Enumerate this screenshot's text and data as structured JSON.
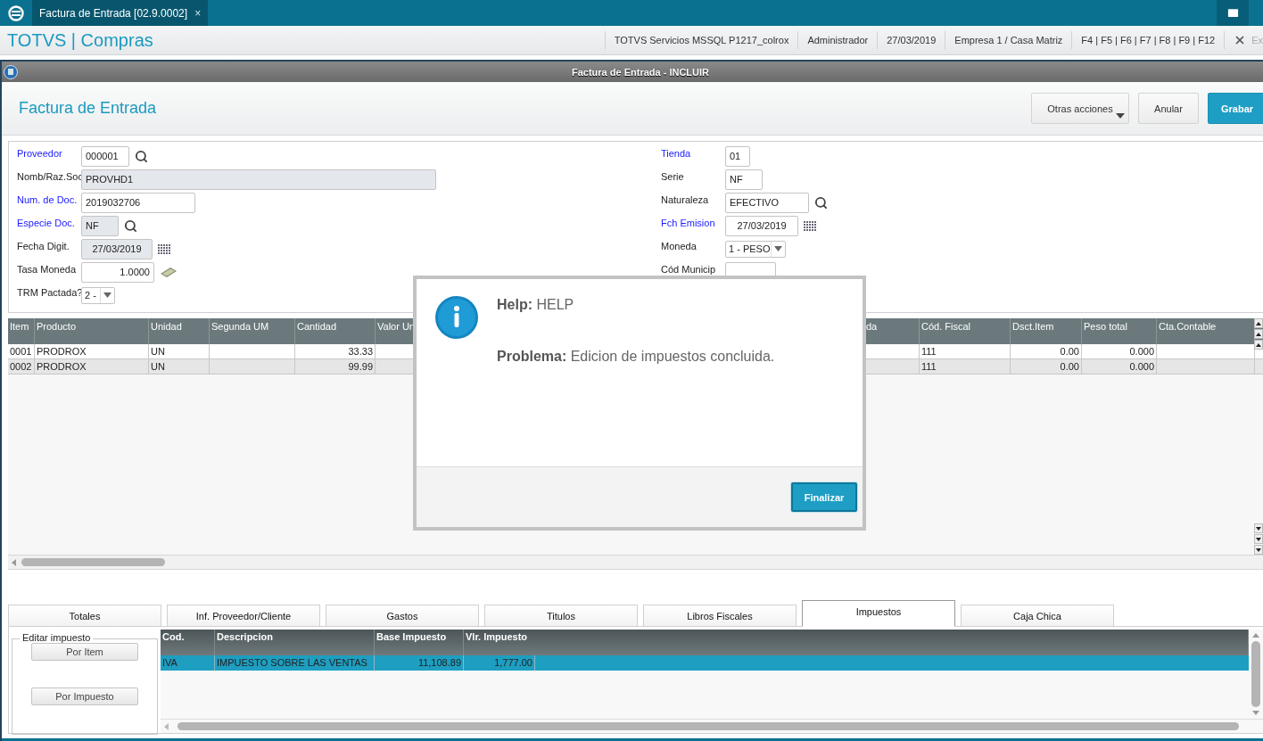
{
  "top_bar": {
    "tab": {
      "title": "Factura de Entrada [02.9.0002]",
      "close": "×"
    }
  },
  "app_bar": {
    "title": "TOTVS | Compras",
    "info": [
      "TOTVS Servicios MSSQL P1217_colrox",
      "Administrador",
      "27/03/2019",
      "Empresa 1 / Casa Matriz",
      "F4 | F5 | F6 | F7 | F8 | F9 | F12"
    ],
    "exit": "Ex"
  },
  "window": {
    "title": "Factura de Entrada - INCLUIR"
  },
  "page": {
    "title": "Factura de Entrada",
    "buttons": [
      {
        "label": "Otras acciones",
        "kind": "menu"
      },
      {
        "label": "Anular",
        "kind": "plain"
      },
      {
        "label": "Grabar",
        "kind": "primary"
      }
    ]
  },
  "form": {
    "left": [
      {
        "label": "Proveedor",
        "required": true,
        "value": "000001",
        "kind": "text",
        "action": {
          "kind": "search"
        }
      },
      {
        "label": "Nomb/Raz.Soc",
        "required": false,
        "value": "PROVHD1",
        "kind": "readonly"
      },
      {
        "label": "Num. de Doc.",
        "required": true,
        "value": "2019032706",
        "kind": "text"
      },
      {
        "label": "Especie Doc.",
        "required": true,
        "value": "NF",
        "kind": "readonly",
        "action": {
          "kind": "search"
        }
      },
      {
        "label": "Fecha Digit.",
        "required": false,
        "value": "27/03/2019",
        "kind": "readonly-date",
        "action": {
          "kind": "calendar"
        }
      },
      {
        "label": "Tasa Moneda",
        "required": false,
        "value": "1.0000",
        "kind": "number",
        "action": {
          "kind": "money"
        }
      },
      {
        "label": "TRM Pactada?",
        "required": false,
        "value": "2 -",
        "kind": "select"
      }
    ],
    "right": [
      {
        "label": "Tienda",
        "required": true,
        "value": "01",
        "kind": "text"
      },
      {
        "label": "Serie",
        "required": false,
        "value": "NF",
        "kind": "text"
      },
      {
        "label": "Naturaleza",
        "required": false,
        "value": "EFECTIVO",
        "kind": "text",
        "action": {
          "kind": "search"
        }
      },
      {
        "label": "Fch Emision",
        "required": true,
        "value": "27/03/2019",
        "kind": "date",
        "action": {
          "kind": "calendar"
        }
      },
      {
        "label": "Moneda",
        "required": false,
        "value": "1 - PESO",
        "kind": "select"
      },
      {
        "label": "Cód Municip",
        "required": false,
        "kind": "text"
      }
    ]
  },
  "items": {
    "columns": [
      "Item",
      "Producto",
      "Unidad",
      "Segunda UM",
      "Cantidad",
      "Valor Un",
      "da",
      "Cód. Fiscal",
      "Dsct.Item",
      "Peso total",
      "Cta.Contable"
    ],
    "rows": [
      {
        "item": "0001",
        "producto": "PRODROX",
        "unidad": "UN",
        "cantidad": "33.33",
        "cod_fiscal": "111",
        "dsct_item": "0.00",
        "peso_total": "0.000"
      },
      {
        "item": "0002",
        "producto": "PRODROX",
        "unidad": "UN",
        "cantidad": "99.99",
        "cod_fiscal": "111",
        "dsct_item": "0.00",
        "peso_total": "0.000"
      }
    ]
  },
  "tabs": [
    {
      "label": "Totales",
      "selected": false
    },
    {
      "label": "Inf. Proveedor/Cliente",
      "selected": false
    },
    {
      "label": "Gastos",
      "selected": false
    },
    {
      "label": "Titulos",
      "selected": false
    },
    {
      "label": "Libros Fiscales",
      "selected": false
    },
    {
      "label": "Impuestos",
      "selected": true
    },
    {
      "label": "Caja Chica",
      "selected": false
    }
  ],
  "tax_panel": {
    "group": {
      "legend": "Editar impuesto",
      "buttons": [
        "Por Item",
        "Por Impuesto"
      ]
    },
    "columns": [
      "Cod.",
      "Descripcion",
      "Base Impuesto",
      "Vlr. Impuesto"
    ],
    "rows": [
      {
        "cod": "IVA",
        "descripcion": "IMPUESTO SOBRE LAS VENTAS",
        "base": "11,108.89",
        "valor": "1,777.00",
        "selected": true
      }
    ]
  },
  "dialog": {
    "help": "**Help:** HELP",
    "problem": "**Problema:** Edicion de impuestos concluida.",
    "button": "Finalizar"
  }
}
